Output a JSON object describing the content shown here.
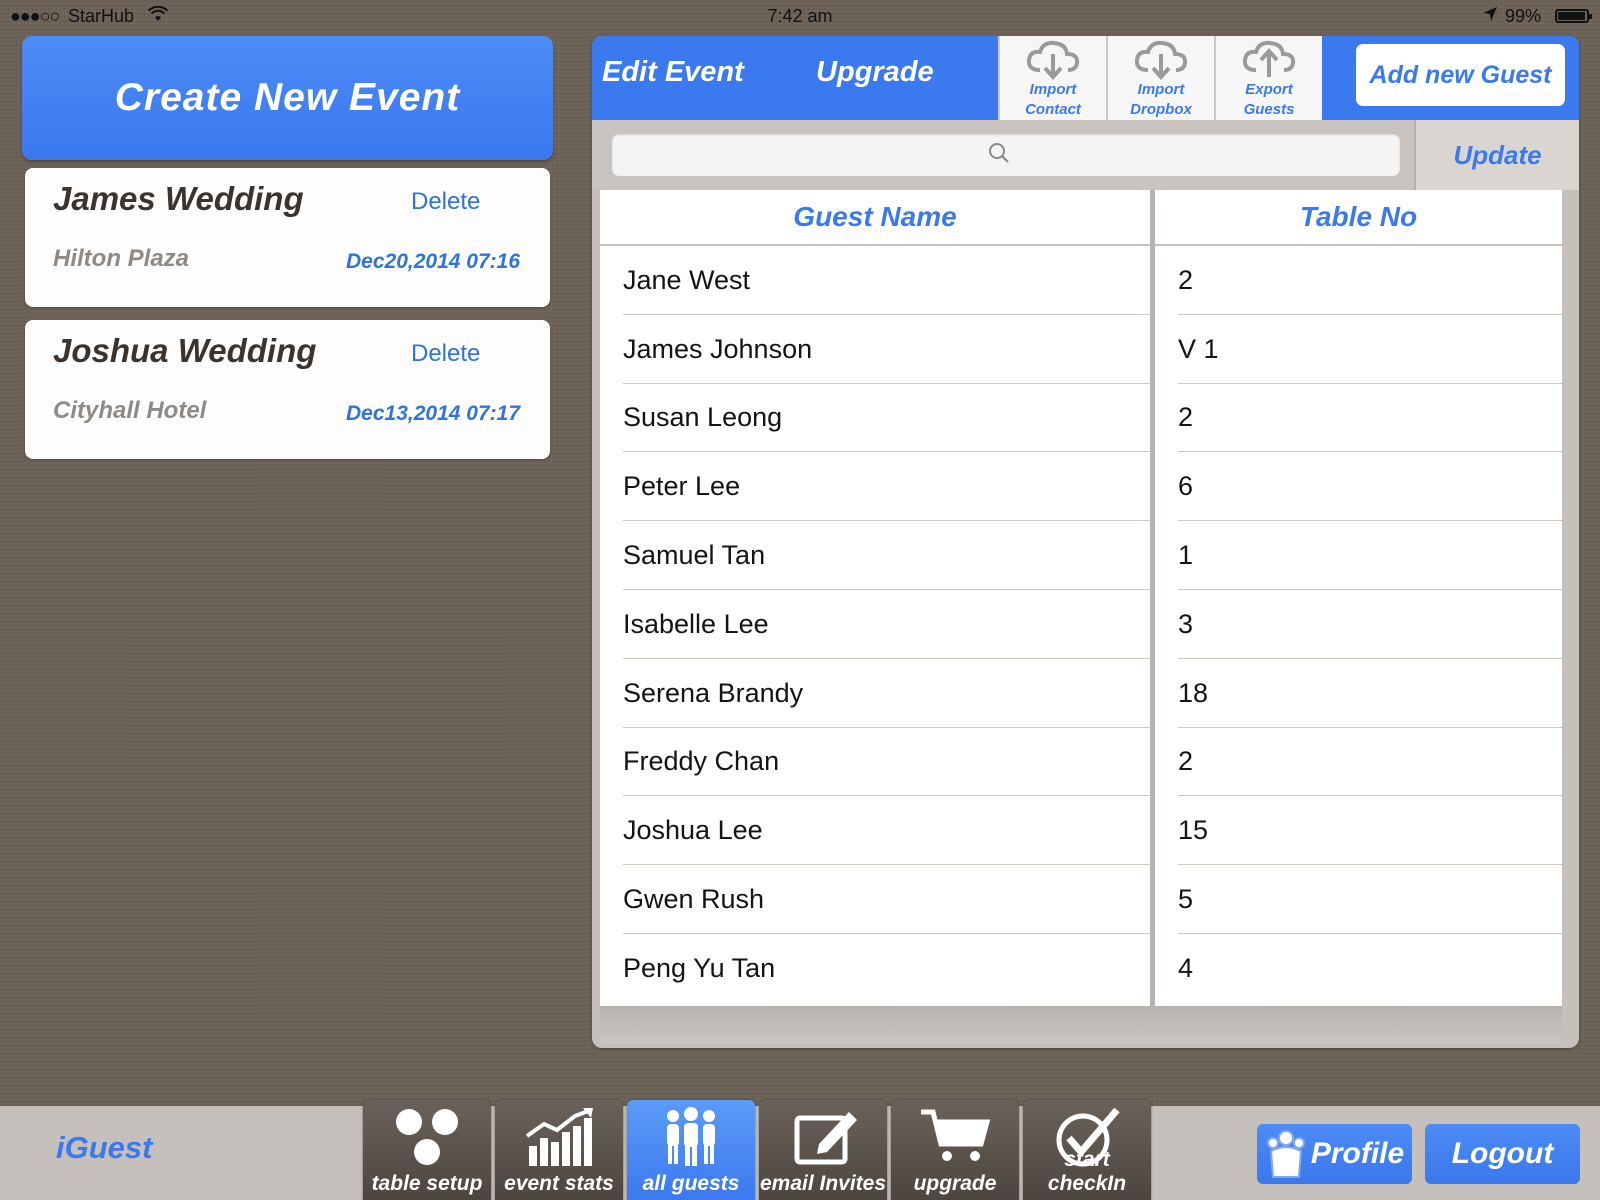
{
  "status_bar": {
    "signal": "●●●○○",
    "carrier": "StarHub",
    "time": "7:42 am",
    "battery": "99%"
  },
  "events": {
    "create_label": "Create New Event",
    "items": [
      {
        "name": "James Wedding",
        "delete_label": "Delete",
        "venue": "Hilton Plaza",
        "date": "Dec20,2014 07:16"
      },
      {
        "name": "Joshua Wedding",
        "delete_label": "Delete",
        "venue": "Cityhall Hotel",
        "date": "Dec13,2014 07:17"
      }
    ]
  },
  "toolbar": {
    "edit_event": "Edit Event",
    "upgrade": "Upgrade",
    "import_contact": [
      "Import",
      "Contact"
    ],
    "import_dropbox": [
      "Import",
      "Dropbox"
    ],
    "export_guests": [
      "Export",
      "Guests"
    ],
    "add_guest": "Add new Guest",
    "update": "Update"
  },
  "search": {
    "placeholder": ""
  },
  "guests": {
    "headers": {
      "name": "Guest Name",
      "table": "Table No"
    },
    "rows": [
      {
        "name": "Jane West",
        "table": "2"
      },
      {
        "name": "James Johnson",
        "table": "V 1"
      },
      {
        "name": "Susan Leong",
        "table": "2"
      },
      {
        "name": "Peter Lee",
        "table": "6"
      },
      {
        "name": "Samuel Tan",
        "table": "1"
      },
      {
        "name": "Isabelle Lee",
        "table": "3"
      },
      {
        "name": "Serena Brandy",
        "table": "18"
      },
      {
        "name": "Freddy Chan",
        "table": "2"
      },
      {
        "name": "Joshua Lee",
        "table": "15"
      },
      {
        "name": "Gwen Rush",
        "table": "5"
      },
      {
        "name": "Peng Yu Tan",
        "table": "4"
      }
    ]
  },
  "bottom_bar": {
    "brand": "iGuest",
    "tabs": [
      {
        "label": "table setup",
        "icon": "table-setup-icon"
      },
      {
        "label": "event stats",
        "icon": "event-stats-icon"
      },
      {
        "label": "all guests",
        "icon": "all-guests-icon",
        "active": true
      },
      {
        "label": "email Invites",
        "icon": "email-invites-icon"
      },
      {
        "label": "upgrade",
        "icon": "cart-icon"
      },
      {
        "label": "start checkIn",
        "icon": "checkmark-icon"
      }
    ],
    "profile": "Profile",
    "logout": "Logout"
  },
  "colors": {
    "accent": "#3b79ee",
    "background": "#6d6257",
    "panel": "#c5c0bb"
  }
}
